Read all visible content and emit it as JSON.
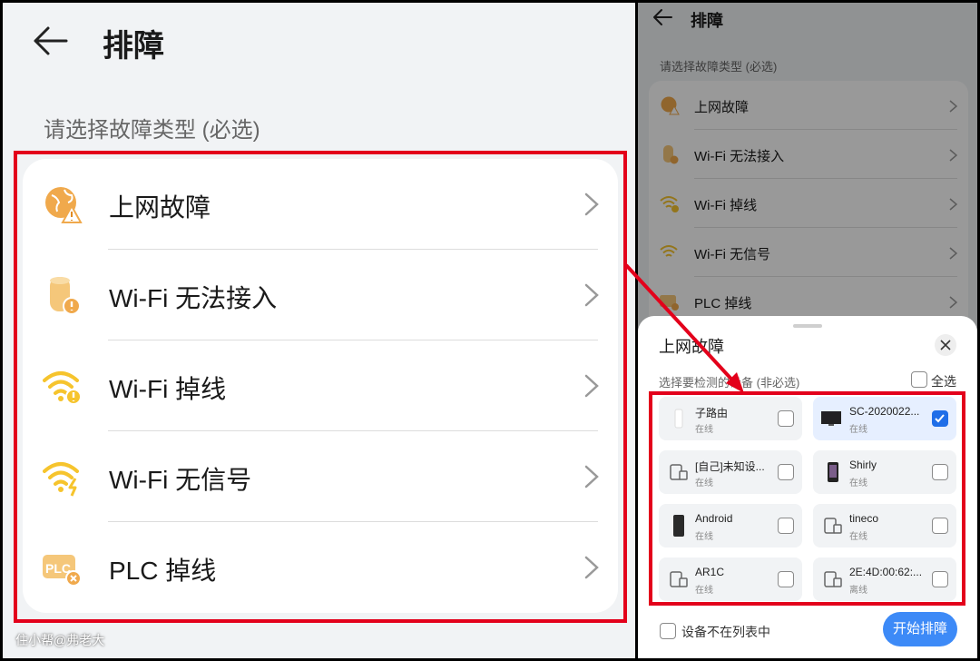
{
  "left": {
    "title": "排障",
    "subtitle": "请选择故障类型 (必选)",
    "items": [
      {
        "label": "上网故障",
        "icon": "globe-warning-icon"
      },
      {
        "label": "Wi-Fi 无法接入",
        "icon": "router-warning-icon"
      },
      {
        "label": "Wi-Fi 掉线",
        "icon": "wifi-warning-icon"
      },
      {
        "label": "Wi-Fi 无信号",
        "icon": "wifi-no-signal-icon"
      },
      {
        "label": "PLC 掉线",
        "icon": "plc-error-icon"
      }
    ],
    "watermark": "住小帮@弗老大"
  },
  "right": {
    "title": "排障",
    "subtitle": "请选择故障类型 (必选)",
    "items": [
      {
        "label": "上网故障"
      },
      {
        "label": "Wi-Fi 无法接入"
      },
      {
        "label": "Wi-Fi 掉线"
      },
      {
        "label": "Wi-Fi 无信号"
      },
      {
        "label": "PLC 掉线"
      }
    ]
  },
  "sheet": {
    "title": "上网故障",
    "subtitle": "选择要检测的设备 (非必选)",
    "select_all": "全选",
    "devices": [
      {
        "name": "子路由",
        "status": "在线",
        "checked": false,
        "icon": "sub-router-icon"
      },
      {
        "name": "SC-2020022...",
        "status": "在线",
        "checked": true,
        "icon": "monitor-icon"
      },
      {
        "name": "[自己]未知设...",
        "status": "在线",
        "checked": false,
        "icon": "unknown-device-icon"
      },
      {
        "name": "Shirly",
        "status": "在线",
        "checked": false,
        "icon": "phone-icon"
      },
      {
        "name": "Android",
        "status": "在线",
        "checked": false,
        "icon": "android-phone-icon"
      },
      {
        "name": "tineco",
        "status": "在线",
        "checked": false,
        "icon": "unknown-device-icon"
      },
      {
        "name": "AR1C",
        "status": "在线",
        "checked": false,
        "icon": "unknown-device-icon"
      },
      {
        "name": "2E:4D:00:62:...",
        "status": "离线",
        "checked": false,
        "icon": "unknown-device-icon"
      }
    ],
    "not_in_list": "设备不在列表中",
    "start_button": "开始排障"
  },
  "colors": {
    "highlight_red": "#e3001b",
    "accent_blue": "#3d8af7",
    "icon_orange": "#f0a94c",
    "icon_yellow": "#f6c42d"
  }
}
